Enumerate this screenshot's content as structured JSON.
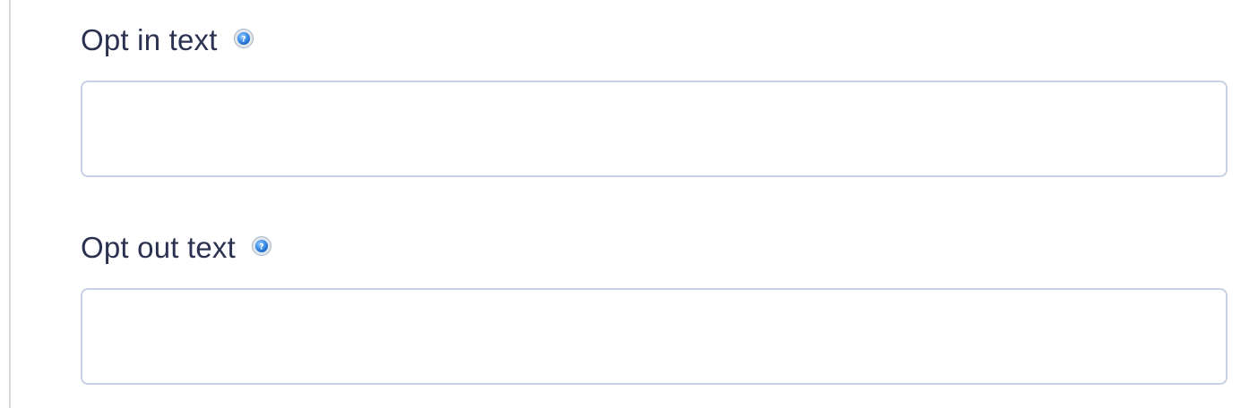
{
  "fields": [
    {
      "label": "Opt in text",
      "help_icon": "question-help-icon",
      "value": ""
    },
    {
      "label": "Opt out text",
      "help_icon": "question-help-icon",
      "value": ""
    }
  ],
  "colors": {
    "label": "#2b3150",
    "field_border": "#c8d1e3",
    "help_icon": "#3b8ee8"
  }
}
